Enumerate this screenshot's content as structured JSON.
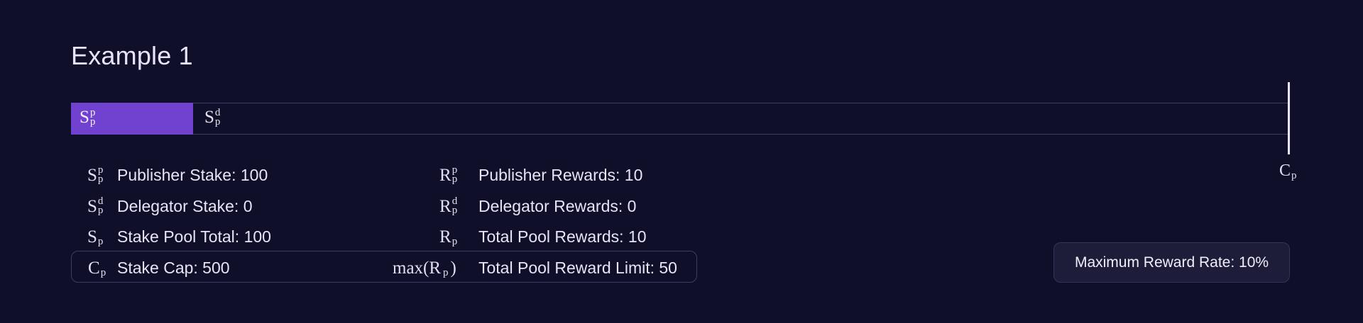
{
  "title": "Example 1",
  "bar": {
    "publisher_share": 0.2,
    "publisher_label": {
      "base": "S",
      "sup": "p",
      "sub": "p"
    },
    "delegator_label": {
      "base": "S",
      "sup": "d",
      "sub": "p"
    },
    "cap_label": {
      "base": "C",
      "sub": "p"
    }
  },
  "legend": [
    {
      "sym": {
        "base": "S",
        "sup": "p",
        "sub": "p"
      },
      "text": "Publisher Stake: 100"
    },
    {
      "sym": {
        "base": "S",
        "sup": "d",
        "sub": "p"
      },
      "text": "Delegator Stake: 0"
    },
    {
      "sym": {
        "base": "S",
        "sub": "p"
      },
      "text": "Stake Pool Total: 100"
    },
    {
      "sym": {
        "base": "C",
        "sub": "p"
      },
      "text": "Stake Cap: 500"
    }
  ],
  "rewards": [
    {
      "sym": {
        "base": "R",
        "sup": "p",
        "sub": "p"
      },
      "text": "Publisher Rewards: 10"
    },
    {
      "sym": {
        "base": "R",
        "sup": "d",
        "sub": "p"
      },
      "text": "Delegator Rewards: 0"
    },
    {
      "sym": {
        "base": "R",
        "sub": "p"
      },
      "text": "Total Pool Rewards: 10"
    },
    {
      "sym": {
        "prefix": "max(R",
        "sub": "p",
        "suffix": ")"
      },
      "text": "Total Pool Reward Limit: 50"
    }
  ],
  "max_rate": {
    "label": "Maximum Reward Rate: 10%",
    "value": 0.1
  },
  "colors": {
    "background": "#0f0f2a",
    "publisher_fill": "#7142cf",
    "rate_box": "#1d1d39"
  }
}
